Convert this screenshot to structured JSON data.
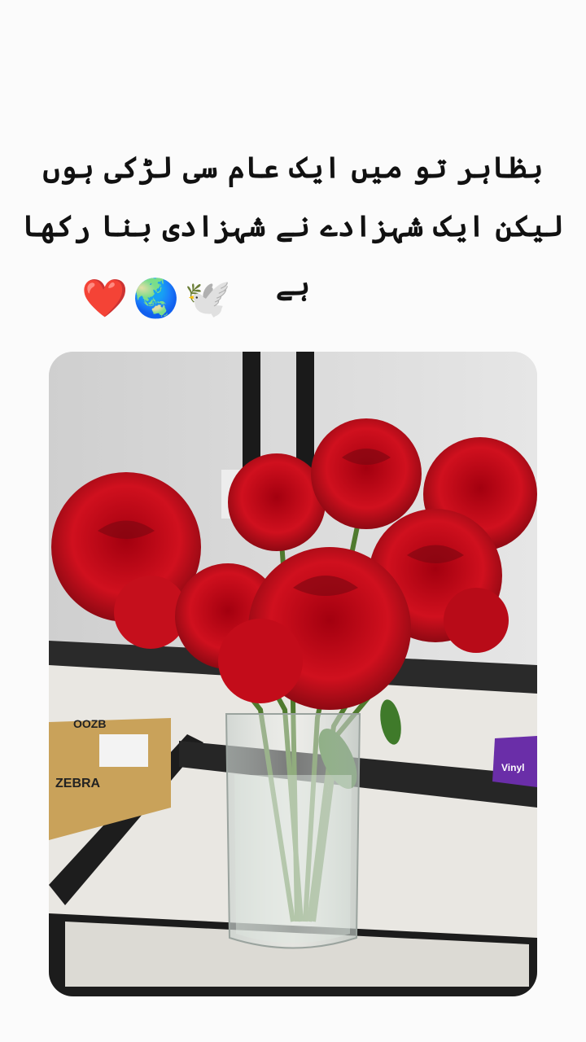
{
  "post": {
    "lines": [
      "بظاہر تو میں ایک عام سی لڑکی ہوں",
      "لیکن ایک شہزادے نے شہزادی بنا رکھا ہے"
    ],
    "emojis": [
      "❤️",
      "🌏",
      "🕊️"
    ]
  },
  "photo": {
    "box_label": "ZEBRA",
    "box_code": "OOZB",
    "package_label": "Vinyl"
  }
}
